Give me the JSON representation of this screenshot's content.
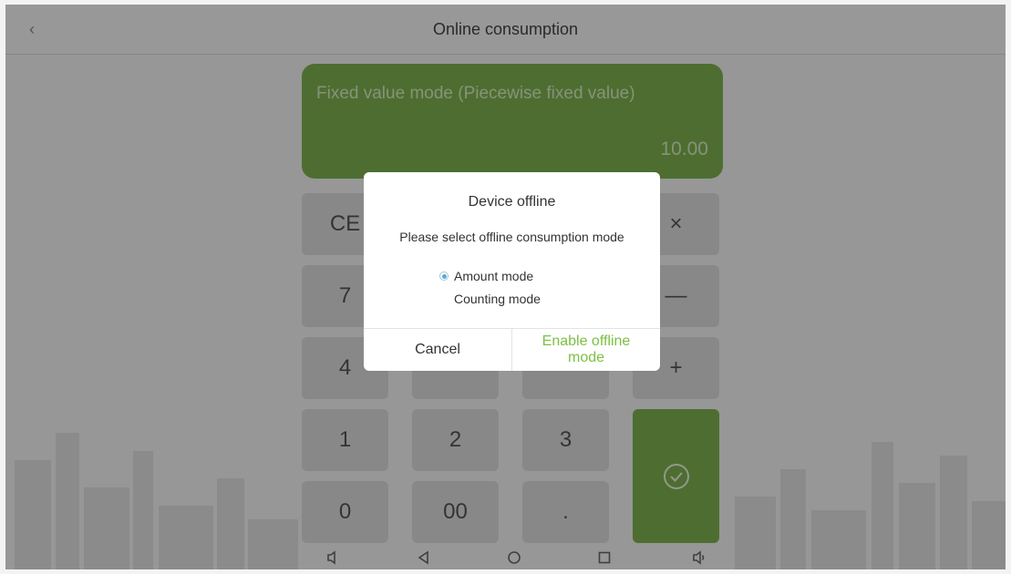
{
  "header": {
    "title": "Online consumption",
    "back_icon": "back-icon"
  },
  "display": {
    "mode": "Fixed value mode (Piecewise fixed value)",
    "amount": "10.00"
  },
  "keypad": {
    "clear": "CE",
    "multiply": "×",
    "seven": "7",
    "minus": "—",
    "four": "4",
    "plus": "+",
    "one": "1",
    "two": "2",
    "three": "3",
    "zero": "0",
    "double_zero": "00",
    "dot": ".",
    "confirm_icon": "check-circle-icon"
  },
  "dialog": {
    "title": "Device offline",
    "message": "Please select offline consumption mode",
    "options": [
      {
        "label": "Amount mode",
        "selected": true
      },
      {
        "label": "Counting mode",
        "selected": false
      }
    ],
    "cancel": "Cancel",
    "confirm": "Enable offline mode"
  },
  "navbar": {
    "icons": [
      "volume-down-icon",
      "back-triangle-icon",
      "home-circle-icon",
      "recents-square-icon",
      "volume-up-icon"
    ]
  },
  "colors": {
    "accent_green": "#7cb24e",
    "dialog_confirm": "#7cc043",
    "radio": "#5aa9d3"
  }
}
